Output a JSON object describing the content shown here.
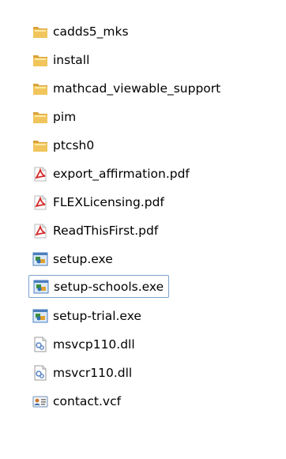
{
  "files": [
    {
      "name": "cadds5_mks",
      "icon": "folder-icon"
    },
    {
      "name": "install",
      "icon": "folder-icon"
    },
    {
      "name": "mathcad_viewable_support",
      "icon": "folder-icon"
    },
    {
      "name": "pim",
      "icon": "folder-icon"
    },
    {
      "name": "ptcsh0",
      "icon": "folder-icon"
    },
    {
      "name": "export_affirmation.pdf",
      "icon": "pdf-icon"
    },
    {
      "name": "FLEXLicensing.pdf",
      "icon": "pdf-icon"
    },
    {
      "name": "ReadThisFirst.pdf",
      "icon": "pdf-icon"
    },
    {
      "name": "setup.exe",
      "icon": "installer-exe-icon"
    },
    {
      "name": "setup-schools.exe",
      "icon": "installer-exe-icon"
    },
    {
      "name": "setup-trial.exe",
      "icon": "installer-exe-icon"
    },
    {
      "name": "msvcp110.dll",
      "icon": "dll-file-icon"
    },
    {
      "name": "msvcr110.dll",
      "icon": "dll-file-icon"
    },
    {
      "name": "contact.vcf",
      "icon": "contact-card-icon"
    }
  ],
  "selected_item": "setup-schools.exe",
  "colors": {
    "folder": "#e8b84a",
    "pdf": "#d42a2a",
    "selection_border": "#7da2ce"
  }
}
